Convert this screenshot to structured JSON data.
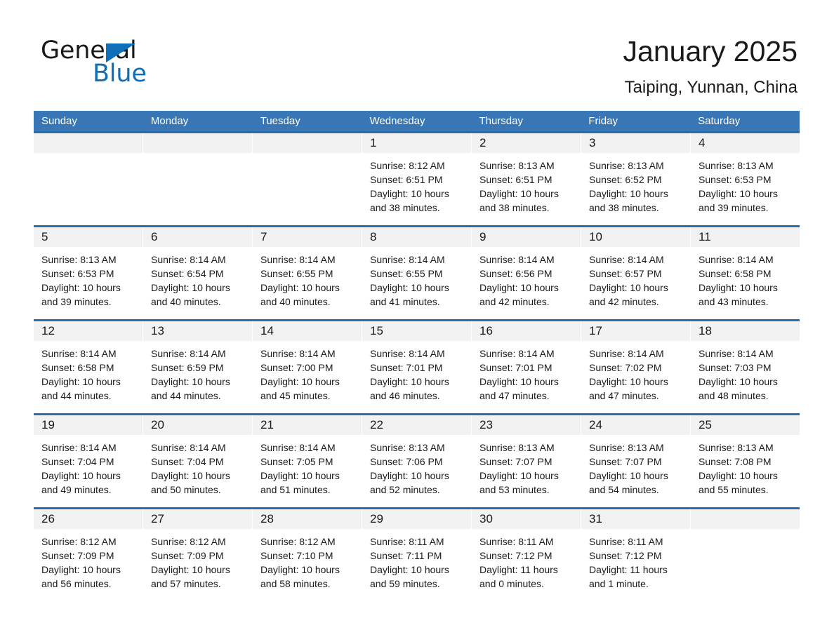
{
  "brand": {
    "name_part1": "General",
    "name_part2": "Blue",
    "triangle_color": "#0d6fb8"
  },
  "header": {
    "month_title": "January 2025",
    "location": "Taiping, Yunnan, China"
  },
  "theme": {
    "header_blue": "#3876b5",
    "row_rule_blue": "#2e6da4",
    "day_band_gray": "#f2f2f2"
  },
  "calendar": {
    "weekdays": [
      "Sunday",
      "Monday",
      "Tuesday",
      "Wednesday",
      "Thursday",
      "Friday",
      "Saturday"
    ],
    "weeks": [
      [
        {
          "day": "",
          "lines": []
        },
        {
          "day": "",
          "lines": []
        },
        {
          "day": "",
          "lines": []
        },
        {
          "day": "1",
          "lines": [
            "Sunrise: 8:12 AM",
            "Sunset: 6:51 PM",
            "Daylight: 10 hours",
            "and 38 minutes."
          ]
        },
        {
          "day": "2",
          "lines": [
            "Sunrise: 8:13 AM",
            "Sunset: 6:51 PM",
            "Daylight: 10 hours",
            "and 38 minutes."
          ]
        },
        {
          "day": "3",
          "lines": [
            "Sunrise: 8:13 AM",
            "Sunset: 6:52 PM",
            "Daylight: 10 hours",
            "and 38 minutes."
          ]
        },
        {
          "day": "4",
          "lines": [
            "Sunrise: 8:13 AM",
            "Sunset: 6:53 PM",
            "Daylight: 10 hours",
            "and 39 minutes."
          ]
        }
      ],
      [
        {
          "day": "5",
          "lines": [
            "Sunrise: 8:13 AM",
            "Sunset: 6:53 PM",
            "Daylight: 10 hours",
            "and 39 minutes."
          ]
        },
        {
          "day": "6",
          "lines": [
            "Sunrise: 8:14 AM",
            "Sunset: 6:54 PM",
            "Daylight: 10 hours",
            "and 40 minutes."
          ]
        },
        {
          "day": "7",
          "lines": [
            "Sunrise: 8:14 AM",
            "Sunset: 6:55 PM",
            "Daylight: 10 hours",
            "and 40 minutes."
          ]
        },
        {
          "day": "8",
          "lines": [
            "Sunrise: 8:14 AM",
            "Sunset: 6:55 PM",
            "Daylight: 10 hours",
            "and 41 minutes."
          ]
        },
        {
          "day": "9",
          "lines": [
            "Sunrise: 8:14 AM",
            "Sunset: 6:56 PM",
            "Daylight: 10 hours",
            "and 42 minutes."
          ]
        },
        {
          "day": "10",
          "lines": [
            "Sunrise: 8:14 AM",
            "Sunset: 6:57 PM",
            "Daylight: 10 hours",
            "and 42 minutes."
          ]
        },
        {
          "day": "11",
          "lines": [
            "Sunrise: 8:14 AM",
            "Sunset: 6:58 PM",
            "Daylight: 10 hours",
            "and 43 minutes."
          ]
        }
      ],
      [
        {
          "day": "12",
          "lines": [
            "Sunrise: 8:14 AM",
            "Sunset: 6:58 PM",
            "Daylight: 10 hours",
            "and 44 minutes."
          ]
        },
        {
          "day": "13",
          "lines": [
            "Sunrise: 8:14 AM",
            "Sunset: 6:59 PM",
            "Daylight: 10 hours",
            "and 44 minutes."
          ]
        },
        {
          "day": "14",
          "lines": [
            "Sunrise: 8:14 AM",
            "Sunset: 7:00 PM",
            "Daylight: 10 hours",
            "and 45 minutes."
          ]
        },
        {
          "day": "15",
          "lines": [
            "Sunrise: 8:14 AM",
            "Sunset: 7:01 PM",
            "Daylight: 10 hours",
            "and 46 minutes."
          ]
        },
        {
          "day": "16",
          "lines": [
            "Sunrise: 8:14 AM",
            "Sunset: 7:01 PM",
            "Daylight: 10 hours",
            "and 47 minutes."
          ]
        },
        {
          "day": "17",
          "lines": [
            "Sunrise: 8:14 AM",
            "Sunset: 7:02 PM",
            "Daylight: 10 hours",
            "and 47 minutes."
          ]
        },
        {
          "day": "18",
          "lines": [
            "Sunrise: 8:14 AM",
            "Sunset: 7:03 PM",
            "Daylight: 10 hours",
            "and 48 minutes."
          ]
        }
      ],
      [
        {
          "day": "19",
          "lines": [
            "Sunrise: 8:14 AM",
            "Sunset: 7:04 PM",
            "Daylight: 10 hours",
            "and 49 minutes."
          ]
        },
        {
          "day": "20",
          "lines": [
            "Sunrise: 8:14 AM",
            "Sunset: 7:04 PM",
            "Daylight: 10 hours",
            "and 50 minutes."
          ]
        },
        {
          "day": "21",
          "lines": [
            "Sunrise: 8:14 AM",
            "Sunset: 7:05 PM",
            "Daylight: 10 hours",
            "and 51 minutes."
          ]
        },
        {
          "day": "22",
          "lines": [
            "Sunrise: 8:13 AM",
            "Sunset: 7:06 PM",
            "Daylight: 10 hours",
            "and 52 minutes."
          ]
        },
        {
          "day": "23",
          "lines": [
            "Sunrise: 8:13 AM",
            "Sunset: 7:07 PM",
            "Daylight: 10 hours",
            "and 53 minutes."
          ]
        },
        {
          "day": "24",
          "lines": [
            "Sunrise: 8:13 AM",
            "Sunset: 7:07 PM",
            "Daylight: 10 hours",
            "and 54 minutes."
          ]
        },
        {
          "day": "25",
          "lines": [
            "Sunrise: 8:13 AM",
            "Sunset: 7:08 PM",
            "Daylight: 10 hours",
            "and 55 minutes."
          ]
        }
      ],
      [
        {
          "day": "26",
          "lines": [
            "Sunrise: 8:12 AM",
            "Sunset: 7:09 PM",
            "Daylight: 10 hours",
            "and 56 minutes."
          ]
        },
        {
          "day": "27",
          "lines": [
            "Sunrise: 8:12 AM",
            "Sunset: 7:09 PM",
            "Daylight: 10 hours",
            "and 57 minutes."
          ]
        },
        {
          "day": "28",
          "lines": [
            "Sunrise: 8:12 AM",
            "Sunset: 7:10 PM",
            "Daylight: 10 hours",
            "and 58 minutes."
          ]
        },
        {
          "day": "29",
          "lines": [
            "Sunrise: 8:11 AM",
            "Sunset: 7:11 PM",
            "Daylight: 10 hours",
            "and 59 minutes."
          ]
        },
        {
          "day": "30",
          "lines": [
            "Sunrise: 8:11 AM",
            "Sunset: 7:12 PM",
            "Daylight: 11 hours",
            "and 0 minutes."
          ]
        },
        {
          "day": "31",
          "lines": [
            "Sunrise: 8:11 AM",
            "Sunset: 7:12 PM",
            "Daylight: 11 hours",
            "and 1 minute."
          ]
        },
        {
          "day": "",
          "lines": []
        }
      ]
    ]
  }
}
